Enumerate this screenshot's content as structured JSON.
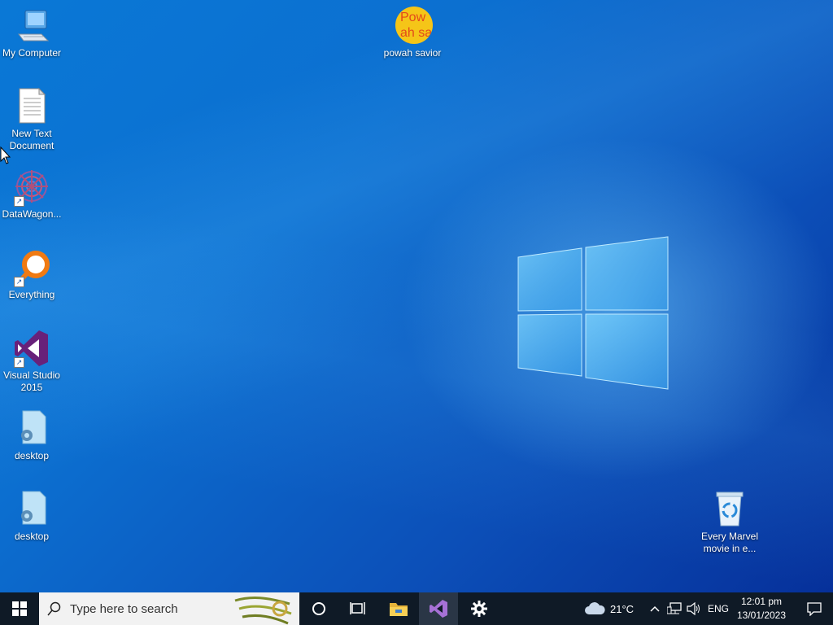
{
  "desktop": {
    "icons": [
      {
        "label": "My Computer",
        "icon": "computer-icon"
      },
      {
        "label": "New Text Document",
        "icon": "text-file-icon"
      },
      {
        "label": "DataWagon...",
        "icon": "datawagon-icon"
      },
      {
        "label": "Everything",
        "icon": "everything-search-icon"
      },
      {
        "label": "Visual Studio 2015",
        "icon": "visual-studio-icon"
      },
      {
        "label": "desktop",
        "icon": "settings-file-icon"
      },
      {
        "label": "desktop",
        "icon": "settings-file-icon"
      },
      {
        "label": "powah savior",
        "icon": "powah-savior-icon",
        "icon_text": "Powah savior"
      },
      {
        "label": "Every Marvel movie in e...",
        "icon": "recycle-bin-icon"
      }
    ]
  },
  "taskbar": {
    "search_placeholder": "Type here to search",
    "pinned": [
      {
        "name": "cortana",
        "icon": "circle-icon"
      },
      {
        "name": "task-view",
        "icon": "task-view-icon"
      },
      {
        "name": "file-explorer",
        "icon": "folder-icon"
      },
      {
        "name": "visual-studio",
        "icon": "visual-studio-icon"
      },
      {
        "name": "settings",
        "icon": "gear-icon"
      }
    ],
    "weather": {
      "temperature": "21°C",
      "icon": "cloud-icon"
    },
    "language": "ENG",
    "time": "12:01 pm",
    "date": "13/01/2023"
  },
  "colors": {
    "desktop_blue": "#0c6fd0",
    "taskbar_bg": "#0f1a26",
    "visual_studio_purple": "#68217a"
  }
}
